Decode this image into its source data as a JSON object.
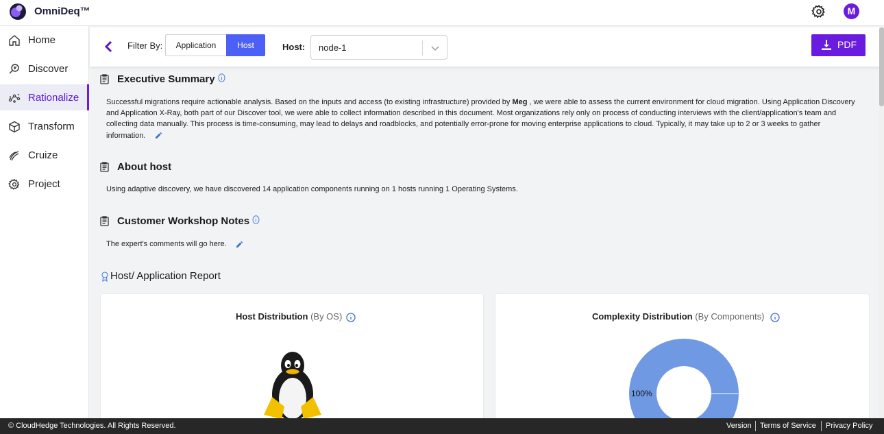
{
  "app": {
    "brand": "OmniDeq™",
    "avatar_initial": "M",
    "accent": "#6a1be0"
  },
  "sidebar": {
    "items": [
      {
        "label": "Home",
        "icon": "home-icon"
      },
      {
        "label": "Discover",
        "icon": "discover-icon"
      },
      {
        "label": "Rationalize",
        "icon": "rationalize-icon",
        "active": true
      },
      {
        "label": "Transform",
        "icon": "cube-icon"
      },
      {
        "label": "Cruize",
        "icon": "cruize-icon"
      },
      {
        "label": "Project",
        "icon": "gear-icon"
      }
    ]
  },
  "filter": {
    "label": "Filter By:",
    "options": [
      "Application",
      "Host"
    ],
    "selected": "Host",
    "host_label": "Host:",
    "host_value": "node-1",
    "pdf_label": "PDF"
  },
  "executive_summary": {
    "title": "Executive Summary",
    "text_before": "Successful migrations require actionable analysis. Based on the inputs and access (to existing infrastructure) provided by ",
    "user": "Meg",
    "text_after": " , we were able to assess the current environment for cloud migration. Using Application Discovery and Application X-Ray, both part of our Discover tool, we were able to collect information described in this document. Most organizations rely only on process of conducting interviews with the client/application's team and collecting data manually. This process is time-consuming, may lead to delays and roadblocks, and potentially error-prone for moving enterprise applications to cloud. Typically, it may take up to 2 or 3 weeks to gather information."
  },
  "about_host": {
    "title": "About host",
    "text": "Using adaptive discovery, we have discovered 14 application components running on 1 hosts running 1 Operating Systems."
  },
  "workshop": {
    "title": "Customer Workshop Notes",
    "text": "The expert's comments will go here."
  },
  "report": {
    "title": "Host/ Application Report",
    "host_card": {
      "title": "Host Distribution",
      "subtitle": "(By OS)"
    },
    "complexity_card": {
      "title": "Complexity Distribution",
      "subtitle": "(By Components)"
    }
  },
  "chart_data": {
    "type": "pie",
    "categories": [
      ""
    ],
    "values": [
      100
    ],
    "data_labels": [
      "100%"
    ],
    "colors": [
      "#7099e4"
    ]
  },
  "footer": {
    "copyright": "© CloudHedge Technologies. All Rights Reserved.",
    "links": [
      "Version",
      "Terms of Service",
      "Privacy Policy"
    ]
  }
}
